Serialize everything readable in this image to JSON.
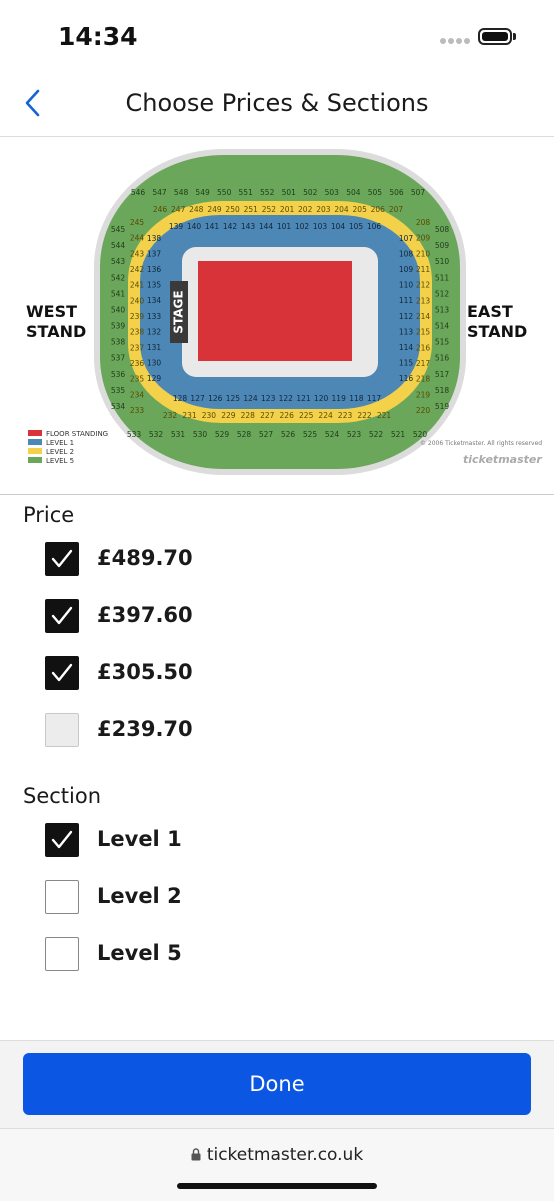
{
  "status_bar": {
    "time": "14:34"
  },
  "nav": {
    "title": "Choose Prices & Sections"
  },
  "map": {
    "west_line1": "WEST",
    "west_line2": "STAND",
    "east_line1": "EAST",
    "east_line2": "STAND",
    "stage": "STAGE",
    "legend": [
      "FLOOR STANDING",
      "LEVEL 1",
      "LEVEL 2",
      "LEVEL 5"
    ],
    "copyright": "© 2006 Ticketmaster. All rights reserved",
    "brand": "ticketmaster",
    "colors": {
      "floor": "#d73338",
      "level1": "#4d87b5",
      "level2": "#f3d14a",
      "level5": "#6ba75a"
    },
    "level5_top": [
      "546",
      "547",
      "548",
      "549",
      "550",
      "551",
      "552",
      "501",
      "502",
      "503",
      "504",
      "505",
      "506",
      "507"
    ],
    "level2_top": [
      "246",
      "247",
      "248",
      "249",
      "250",
      "251",
      "252",
      "201",
      "202",
      "203",
      "204",
      "205",
      "206",
      "207"
    ],
    "level1_top": [
      "139",
      "140",
      "141",
      "142",
      "143",
      "144",
      "101",
      "102",
      "103",
      "104",
      "105",
      "106"
    ],
    "level5_bottom": [
      "533",
      "532",
      "531",
      "530",
      "529",
      "528",
      "527",
      "526",
      "525",
      "524",
      "523",
      "522",
      "521",
      "520"
    ],
    "level2_bottom": [
      "232",
      "231",
      "230",
      "229",
      "228",
      "227",
      "226",
      "225",
      "224",
      "223",
      "222",
      "221"
    ],
    "level1_bottom": [
      "128",
      "127",
      "126",
      "125",
      "124",
      "123",
      "122",
      "121",
      "120",
      "119",
      "118",
      "117"
    ],
    "level5_left": [
      "545",
      "544",
      "543",
      "542",
      "541",
      "540",
      "539",
      "538",
      "537",
      "536",
      "535",
      "534"
    ],
    "level2_left": [
      "245",
      "244",
      "243",
      "242",
      "241",
      "240",
      "239",
      "238",
      "237",
      "236",
      "235",
      "234",
      "233"
    ],
    "level1_left": [
      "138",
      "137",
      "136",
      "135",
      "134",
      "133",
      "132",
      "131",
      "130",
      "129"
    ],
    "level5_right": [
      "508",
      "509",
      "510",
      "511",
      "512",
      "513",
      "514",
      "515",
      "516",
      "517",
      "518",
      "519"
    ],
    "level2_right": [
      "208",
      "209",
      "210",
      "211",
      "212",
      "213",
      "214",
      "215",
      "216",
      "217",
      "218",
      "219",
      "220"
    ],
    "level1_right": [
      "107",
      "108",
      "109",
      "110",
      "111",
      "112",
      "113",
      "114",
      "115",
      "116"
    ]
  },
  "price": {
    "heading": "Price",
    "options": [
      {
        "label": "£489.70",
        "state": "checked"
      },
      {
        "label": "£397.60",
        "state": "checked"
      },
      {
        "label": "£305.50",
        "state": "checked"
      },
      {
        "label": "£239.70",
        "state": "disabled"
      }
    ]
  },
  "section": {
    "heading": "Section",
    "options": [
      {
        "label": "Level 1",
        "state": "checked"
      },
      {
        "label": "Level 2",
        "state": "unchecked"
      },
      {
        "label": "Level 5",
        "state": "unchecked"
      }
    ]
  },
  "footer": {
    "done_label": "Done"
  },
  "browser": {
    "url": "ticketmaster.co.uk"
  }
}
